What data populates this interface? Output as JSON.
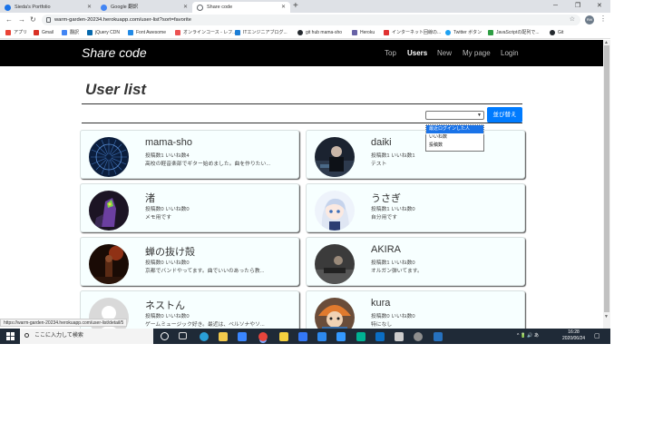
{
  "browser": {
    "tabs": [
      {
        "label": "Sieda's Portfolio",
        "color": "#1a73e8",
        "active": false
      },
      {
        "label": "Google 翻訳",
        "color": "#4285f4",
        "active": false
      },
      {
        "label": "Share code",
        "color": "#5f6368",
        "active": true
      }
    ],
    "new_tab": "+",
    "window_controls": [
      "─",
      "❐",
      "✕"
    ],
    "url": "warm-garden-20234.herokuapp.com/user-list?sort=favorite",
    "profile_initials": "RW",
    "bookmarks": [
      {
        "label": "アプリ",
        "color": "#ea4335"
      },
      {
        "label": "Gmail",
        "color": "#d93025"
      },
      {
        "label": "翻訳",
        "color": "#4285f4"
      },
      {
        "label": "jQuery CDN",
        "color": "#0769ad"
      },
      {
        "label": "Font Awesome",
        "color": "#228ae6"
      },
      {
        "label": "オンラインコース - レフ...",
        "color": "#ec5252"
      },
      {
        "label": "ITエンジニアブログ...",
        "color": "#1c7ed6"
      },
      {
        "label": "git hub mama-sho",
        "color": "#24292e"
      },
      {
        "label": "Heroku",
        "color": "#6762a6"
      },
      {
        "label": "インターネット回線の...",
        "color": "#e03131"
      },
      {
        "label": "Twitter ボタン",
        "color": "#1da1f2"
      },
      {
        "label": "JavaScriptの配列で...",
        "color": "#2f9e44"
      },
      {
        "label": "Git",
        "color": "#24292e"
      }
    ]
  },
  "app": {
    "brand": "Share code",
    "nav": [
      {
        "label": "Top",
        "current": false
      },
      {
        "label": "Users",
        "current": true
      },
      {
        "label": "New",
        "current": false
      },
      {
        "label": "My page",
        "current": false
      },
      {
        "label": "Login",
        "current": false
      }
    ]
  },
  "page": {
    "title": "User list",
    "sort_button": "並び替え",
    "sort_options": [
      {
        "label": "最近ログインした人",
        "selected": true
      },
      {
        "label": "いいね数",
        "selected": false
      },
      {
        "label": "投稿数",
        "selected": false
      }
    ]
  },
  "users": [
    {
      "name": "mama-sho",
      "counts": "投稿数1  いいね数4",
      "bio": "高校の軽音楽部でギター始めました。曲を作りたい...",
      "avatar": "radial"
    },
    {
      "name": "daiki",
      "counts": "投稿数1  いいね数1",
      "bio": "テスト",
      "avatar": "dark-photo"
    },
    {
      "name": "渚",
      "counts": "投稿数0  いいね数0",
      "bio": "メモ用です",
      "avatar": "mecha"
    },
    {
      "name": "うさぎ",
      "counts": "投稿数1  いいね数0",
      "bio": "自分用です",
      "avatar": "anime"
    },
    {
      "name": "蝉の抜け殻",
      "counts": "投稿数0  いいね数0",
      "bio": "京都でバンドやってます。曲でいいのあったら教...",
      "avatar": "stage"
    },
    {
      "name": "AKIRA",
      "counts": "投稿数1  いいね数0",
      "bio": "オルガン弾いてます。",
      "avatar": "gray-photo"
    },
    {
      "name": "ネストん",
      "counts": "投稿数0  いいね数0",
      "bio": "ゲームミュージック好き。最近は、ベルソナやソ...",
      "avatar": "default"
    },
    {
      "name": "kura",
      "counts": "投稿数0  いいね数0",
      "bio": "特になし",
      "avatar": "colorful"
    }
  ],
  "status_url": "https://warm-garden-20234.herokuapp.com/user-list/detail/5",
  "taskbar": {
    "search_placeholder": "ここに入力して検索",
    "icons": [
      {
        "name": "cortana",
        "color": "#ffffff"
      },
      {
        "name": "task-view",
        "color": "#dddddd"
      },
      {
        "name": "edge",
        "color": "#2a9fd8"
      },
      {
        "name": "explorer",
        "color": "#f2c94c"
      },
      {
        "name": "store",
        "color": "#3a86ff"
      },
      {
        "name": "chrome",
        "color": "#e8453c"
      },
      {
        "name": "sticky-notes",
        "color": "#f4d03f"
      },
      {
        "name": "calculator",
        "color": "#3478f6"
      },
      {
        "name": "calendar",
        "color": "#2d89ef"
      },
      {
        "name": "vscode-blue",
        "color": "#3399ff"
      },
      {
        "name": "maps",
        "color": "#00b294"
      },
      {
        "name": "photos",
        "color": "#0b6ec4"
      },
      {
        "name": "terminal",
        "color": "#cccccc"
      },
      {
        "name": "settings",
        "color": "#8e8e8e"
      },
      {
        "name": "powershell",
        "color": "#2671be"
      }
    ],
    "time": "16:28",
    "date": "2020/06/24",
    "tray_text": "^ 🔋 🔊 あ"
  }
}
